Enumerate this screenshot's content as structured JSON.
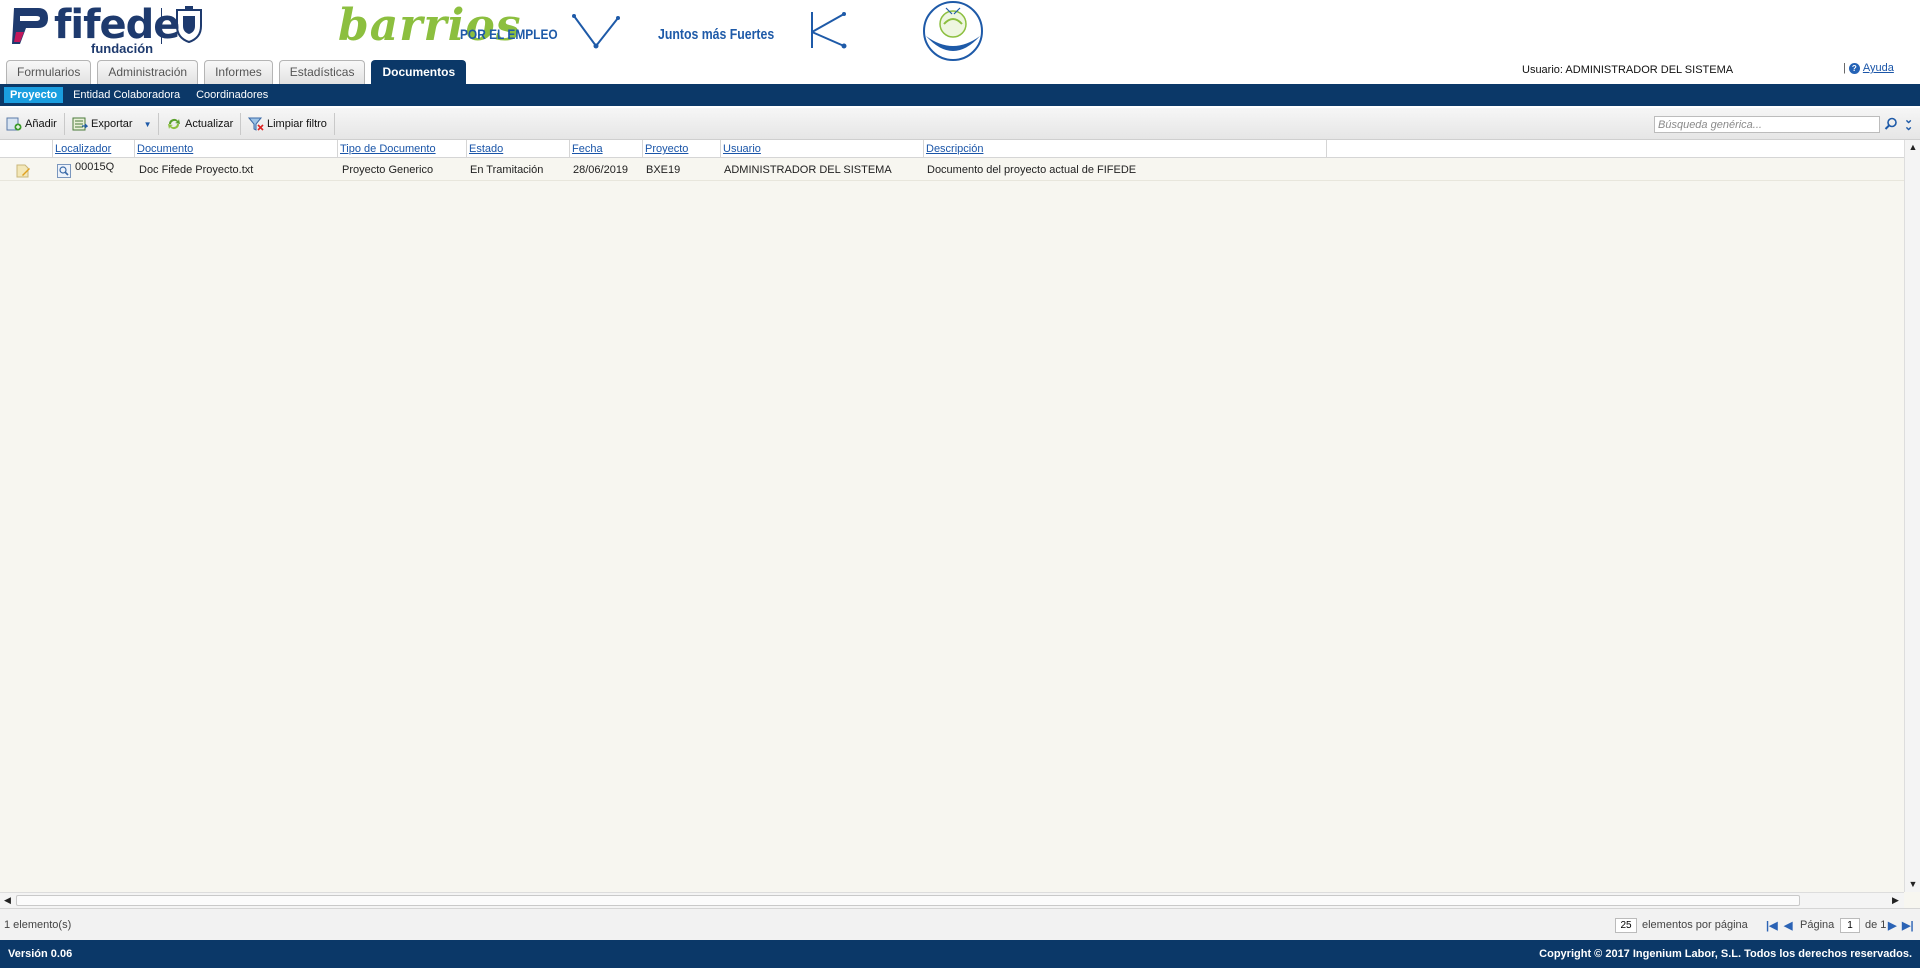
{
  "header": {
    "logo_fifede": {
      "brand": "fifede",
      "sub": "fundación"
    },
    "logo_barrios": {
      "script": "barrios",
      "claim": "POR EL EMPLEO"
    },
    "logo_juntos": {
      "text": "Juntos más Fuertes"
    },
    "tabs": [
      {
        "label": "Formularios",
        "active": false
      },
      {
        "label": "Administración",
        "active": false
      },
      {
        "label": "Informes",
        "active": false
      },
      {
        "label": "Estadísticas",
        "active": false
      },
      {
        "label": "Documentos",
        "active": true
      }
    ],
    "user_label": "Usuario:",
    "user_name": "ADMINISTRADOR DEL SISTEMA",
    "help_separator": "|",
    "help_label": "Ayuda"
  },
  "subnav": {
    "items": [
      {
        "label": "Proyecto",
        "active": true
      },
      {
        "label": "Entidad Colaboradora",
        "active": false
      },
      {
        "label": "Coordinadores",
        "active": false
      }
    ]
  },
  "toolbar": {
    "add_label": "Añadir",
    "export_label": "Exportar",
    "refresh_label": "Actualizar",
    "clear_filter_label": "Limpiar filtro",
    "search_placeholder": "Búsqueda genérica..."
  },
  "grid": {
    "columns": [
      "Localizador",
      "Documento",
      "Tipo de Documento",
      "Estado",
      "Fecha",
      "Proyecto",
      "Usuario",
      "Descripción"
    ],
    "rows": [
      {
        "localizador": "00015Q",
        "documento": "Doc Fifede Proyecto.txt",
        "tipo": "Proyecto Generico",
        "estado": "En Tramitación",
        "fecha": "28/06/2019",
        "proyecto": "BXE19",
        "usuario": "ADMINISTRADOR DEL SISTEMA",
        "descripcion": "Documento del proyecto actual de FIFEDE"
      }
    ]
  },
  "pager": {
    "count_label": "1 elemento(s)",
    "per_page_value": "25",
    "per_page_label": "elementos por página",
    "page_label": "Página",
    "page_value": "1",
    "of_label": "de 1"
  },
  "footer": {
    "version": "Versión 0.06",
    "copyright": "Copyright © 2017 Ingenium Labor, S.L. Todos los derechos reservados."
  },
  "colors": {
    "navy": "#0b3868",
    "active_subnav": "#1a9ee0",
    "link": "#1a55a8",
    "barrios_green": "#8cbf3f"
  }
}
